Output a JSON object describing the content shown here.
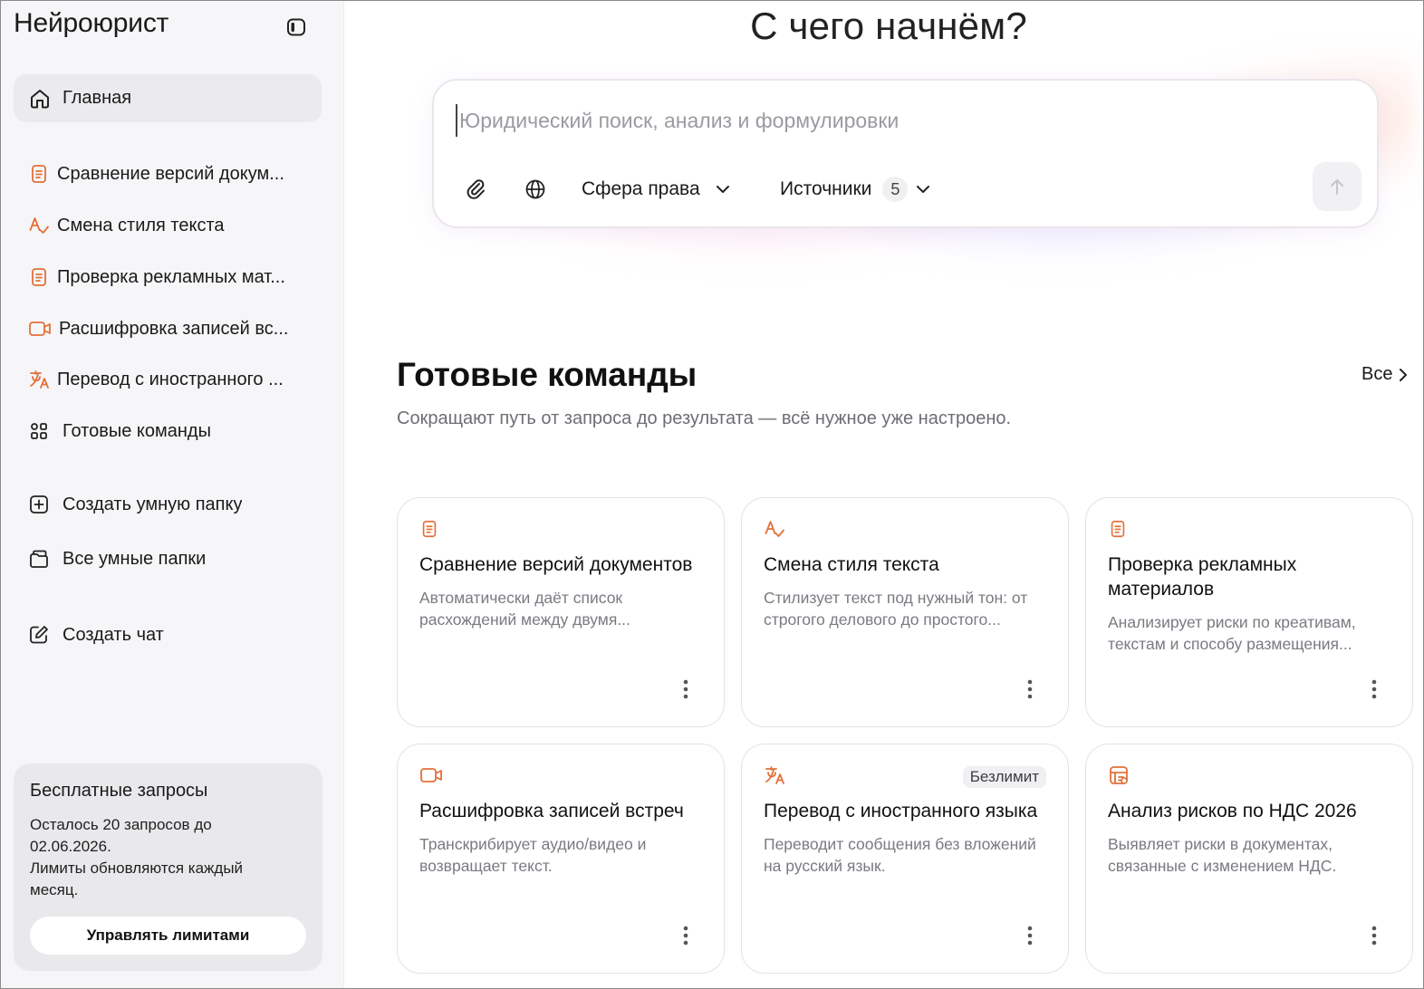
{
  "app": {
    "title": "Нейроюрист"
  },
  "sidebar": {
    "home_label": "Главная",
    "recent": [
      {
        "label": "Сравнение версий докум...",
        "icon": "document-icon"
      },
      {
        "label": "Смена стиля текста",
        "icon": "text-style-icon"
      },
      {
        "label": "Проверка рекламных мат...",
        "icon": "document-icon"
      },
      {
        "label": "Расшифровка записей вс...",
        "icon": "video-icon"
      },
      {
        "label": "Перевод с иностранного ...",
        "icon": "translate-icon"
      }
    ],
    "commands_label": "Готовые команды",
    "create_folder_label": "Создать умную папку",
    "all_folders_label": "Все умные папки",
    "create_chat_label": "Создать чат",
    "limits": {
      "title": "Бесплатные запросы",
      "line1": "Осталось 20 запросов до",
      "line2": "02.06.2026.",
      "line3": "Лимиты обновляются каждый",
      "line4": "месяц.",
      "button": "Управлять лимитами"
    }
  },
  "hero": {
    "title": "С чего начнём?",
    "placeholder": "Юридический поиск, анализ и формулировки",
    "sphere_label": "Сфера права",
    "sources_label": "Источники",
    "sources_count": "5"
  },
  "commands": {
    "title": "Готовые команды",
    "subtitle": "Сокращают путь от запроса до результата — всё нужное уже настроено.",
    "all_label": "Все",
    "cards": [
      {
        "title": "Сравнение версий документов",
        "desc1": "Автоматически даёт список",
        "desc2": "расхождений между двумя...",
        "icon": "document-icon",
        "badge": ""
      },
      {
        "title": "Смена стиля текста",
        "desc1": "Стилизует текст под нужный тон: от",
        "desc2": "строгого делового до простого...",
        "icon": "text-style-icon",
        "badge": ""
      },
      {
        "title": "Проверка рекламных материалов",
        "desc1": "Анализирует риски по креативам,",
        "desc2": "текстам и способу размещения...",
        "icon": "document-icon",
        "badge": ""
      },
      {
        "title": "Расшифровка записей встреч",
        "desc1": "Транскрибирует аудио/видео и",
        "desc2": "возвращает текст.",
        "icon": "video-icon",
        "badge": ""
      },
      {
        "title": "Перевод с иностранного языка",
        "desc1": "Переводит сообщения без вложений",
        "desc2": "на русский язык.",
        "icon": "translate-icon",
        "badge": "Безлимит"
      },
      {
        "title": "Анализ рисков по НДС 2026",
        "desc1": "Выявляет риски в документах,",
        "desc2": "связанные с изменением НДС.",
        "icon": "tax-document-icon",
        "badge": ""
      }
    ]
  },
  "colors": {
    "accent": "#e2703a",
    "sidebar_bg": "#f6f6f8",
    "muted_text": "#7a7a82"
  }
}
